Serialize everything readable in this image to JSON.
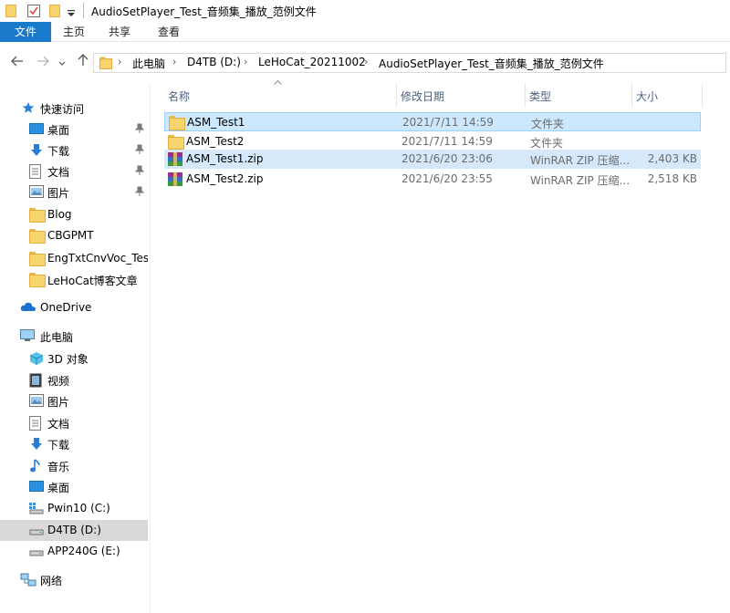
{
  "window": {
    "title": "AudioSetPlayer_Test_音频集_播放_范例文件"
  },
  "ribbon": {
    "tabs": [
      "文件",
      "主页",
      "共享",
      "查看"
    ]
  },
  "address": {
    "breadcrumbs": [
      "此电脑",
      "D4TB (D:)",
      "LeHoCat_20211002",
      "AudioSetPlayer_Test_音频集_播放_范例文件"
    ]
  },
  "nav": {
    "quick_access": "快速访问",
    "quick_items": [
      {
        "label": "桌面",
        "icon": "desktop-icon",
        "pinned": true
      },
      {
        "label": "下载",
        "icon": "download-icon",
        "pinned": true
      },
      {
        "label": "文档",
        "icon": "document-icon",
        "pinned": true
      },
      {
        "label": "图片",
        "icon": "picture-icon",
        "pinned": true
      },
      {
        "label": "Blog",
        "icon": "folder-icon",
        "pinned": false
      },
      {
        "label": "CBGPMT",
        "icon": "folder-icon",
        "pinned": false
      },
      {
        "label": "EngTxtCnvVoc_Test_",
        "icon": "folder-icon",
        "pinned": false
      },
      {
        "label": "LeHoCat博客文章",
        "icon": "folder-icon",
        "pinned": false
      }
    ],
    "onedrive": "OneDrive",
    "this_pc": "此电脑",
    "pc_items": [
      {
        "label": "3D 对象",
        "icon": "3d-objects-icon"
      },
      {
        "label": "视频",
        "icon": "video-icon"
      },
      {
        "label": "图片",
        "icon": "picture-icon"
      },
      {
        "label": "文档",
        "icon": "document-icon"
      },
      {
        "label": "下载",
        "icon": "download-icon"
      },
      {
        "label": "音乐",
        "icon": "music-icon"
      },
      {
        "label": "桌面",
        "icon": "desktop-icon"
      },
      {
        "label": "Pwin10 (C:)",
        "icon": "system-drive-icon"
      },
      {
        "label": "D4TB (D:)",
        "icon": "drive-icon",
        "selected": true
      },
      {
        "label": "APP240G (E:)",
        "icon": "drive-icon"
      }
    ],
    "network": "网络"
  },
  "columns": {
    "name": "名称",
    "date": "修改日期",
    "type": "类型",
    "size": "大小"
  },
  "files": [
    {
      "name": "ASM_Test1",
      "date": "2021/7/11 14:59",
      "type": "文件夹",
      "size": "",
      "icon": "folder-icon"
    },
    {
      "name": "ASM_Test2",
      "date": "2021/7/11 14:59",
      "type": "文件夹",
      "size": "",
      "icon": "folder-icon"
    },
    {
      "name": "ASM_Test1.zip",
      "date": "2021/6/20 23:06",
      "type": "WinRAR ZIP 压缩...",
      "size": "2,403 KB",
      "icon": "winrar-zip-icon"
    },
    {
      "name": "ASM_Test2.zip",
      "date": "2021/6/20 23:55",
      "type": "WinRAR ZIP 压缩...",
      "size": "2,518 KB",
      "icon": "winrar-zip-icon"
    }
  ],
  "colors": {
    "accent": "#1979ca",
    "selection": "#cce8ff",
    "selection_border": "#99d1ff",
    "header_text": "#4d6082"
  }
}
